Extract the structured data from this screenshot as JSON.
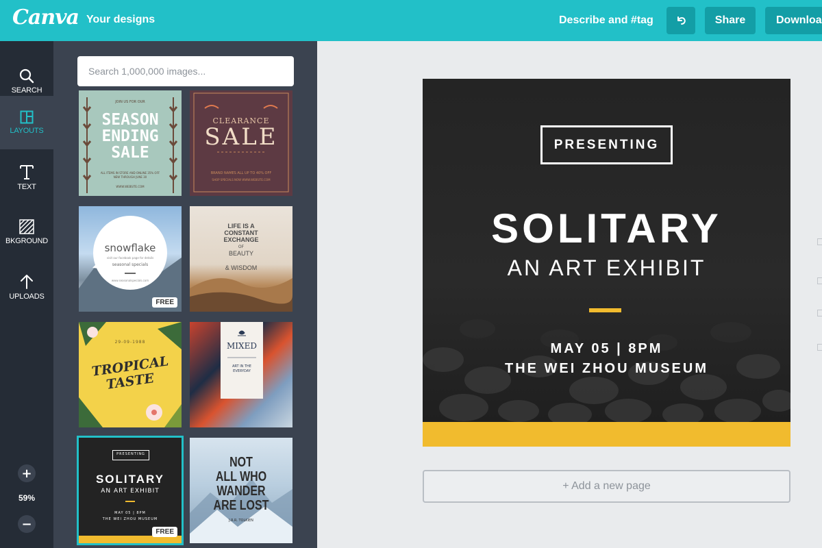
{
  "topbar": {
    "logo": "Canva",
    "your_designs": "Your designs",
    "describe": "Describe and #tag",
    "share_label": "Share",
    "download_label": "Download"
  },
  "rail": {
    "items": [
      {
        "label": "SEARCH",
        "icon": "search-icon"
      },
      {
        "label": "LAYOUTS",
        "icon": "layouts-icon"
      },
      {
        "label": "TEXT",
        "icon": "text-icon"
      },
      {
        "label": "BKGROUND",
        "icon": "background-icon"
      },
      {
        "label": "UPLOADS",
        "icon": "upload-icon"
      }
    ],
    "zoom_in": "+",
    "zoom_out": "−",
    "zoom_level": "59%"
  },
  "panel": {
    "search_placeholder": "Search 1,000,000 images...",
    "free_badge": "FREE",
    "thumbs": {
      "season": {
        "top": "JOIN US FOR OUR",
        "l1": "SEASON",
        "l2": "ENDING",
        "l3": "SALE",
        "sub": "ALL ITEMS IN STORE AND ONLINE 35% OFF",
        "date": "NEW THROUGH JUNE 30",
        "url": "WWW.WEBSITE.COM"
      },
      "clearance": {
        "banner": "CLEARANCE",
        "main": "SALE",
        "sub": "BRAND NAMES ALL UP TO 40% OFF",
        "small": "SHOP SPECIALS NOW WWW.WEBSITE.COM"
      },
      "snowflake": {
        "title": "snowflake",
        "sub1": "visit our facebook page for details",
        "sub2": "seasonal specials",
        "url": "www.seasonalspecials.com"
      },
      "life": {
        "l1": "LIFE IS A",
        "l2": "CONSTANT",
        "l3": "EXCHANGE",
        "l4": "OF",
        "l5": "BEAUTY",
        "l6": "& WISDOM"
      },
      "tropical": {
        "date": "29-09-1988",
        "l1": "TROPICAL",
        "l2": "TASTE"
      },
      "mixed": {
        "title": "MIXED",
        "sub1": "ART IN THE",
        "sub2": "EVERYDAY"
      },
      "solitary": {
        "presenting": "PRESENTING",
        "title": "SOLITARY",
        "sub": "AN ART EXHIBIT",
        "date": "MAY 05 | 8PM",
        "venue": "THE WEI ZHOU MUSEUM"
      },
      "wander": {
        "l1": "NOT",
        "l2": "ALL WHO",
        "l3": "WANDER",
        "l4": "ARE LOST",
        "author": "J.R.R. TOLKIEN"
      }
    }
  },
  "design": {
    "presenting": "PRESENTING",
    "title": "SOLITARY",
    "subtitle": "AN ART EXHIBIT",
    "date": "MAY 05 | 8PM",
    "venue": "THE WEI ZHOU MUSEUM"
  },
  "add_page": "+ Add a new page",
  "colors": {
    "topbar": "#22c0c8",
    "accent": "#f1bb2e",
    "rail": "#252c36",
    "panel": "#3b4350"
  }
}
